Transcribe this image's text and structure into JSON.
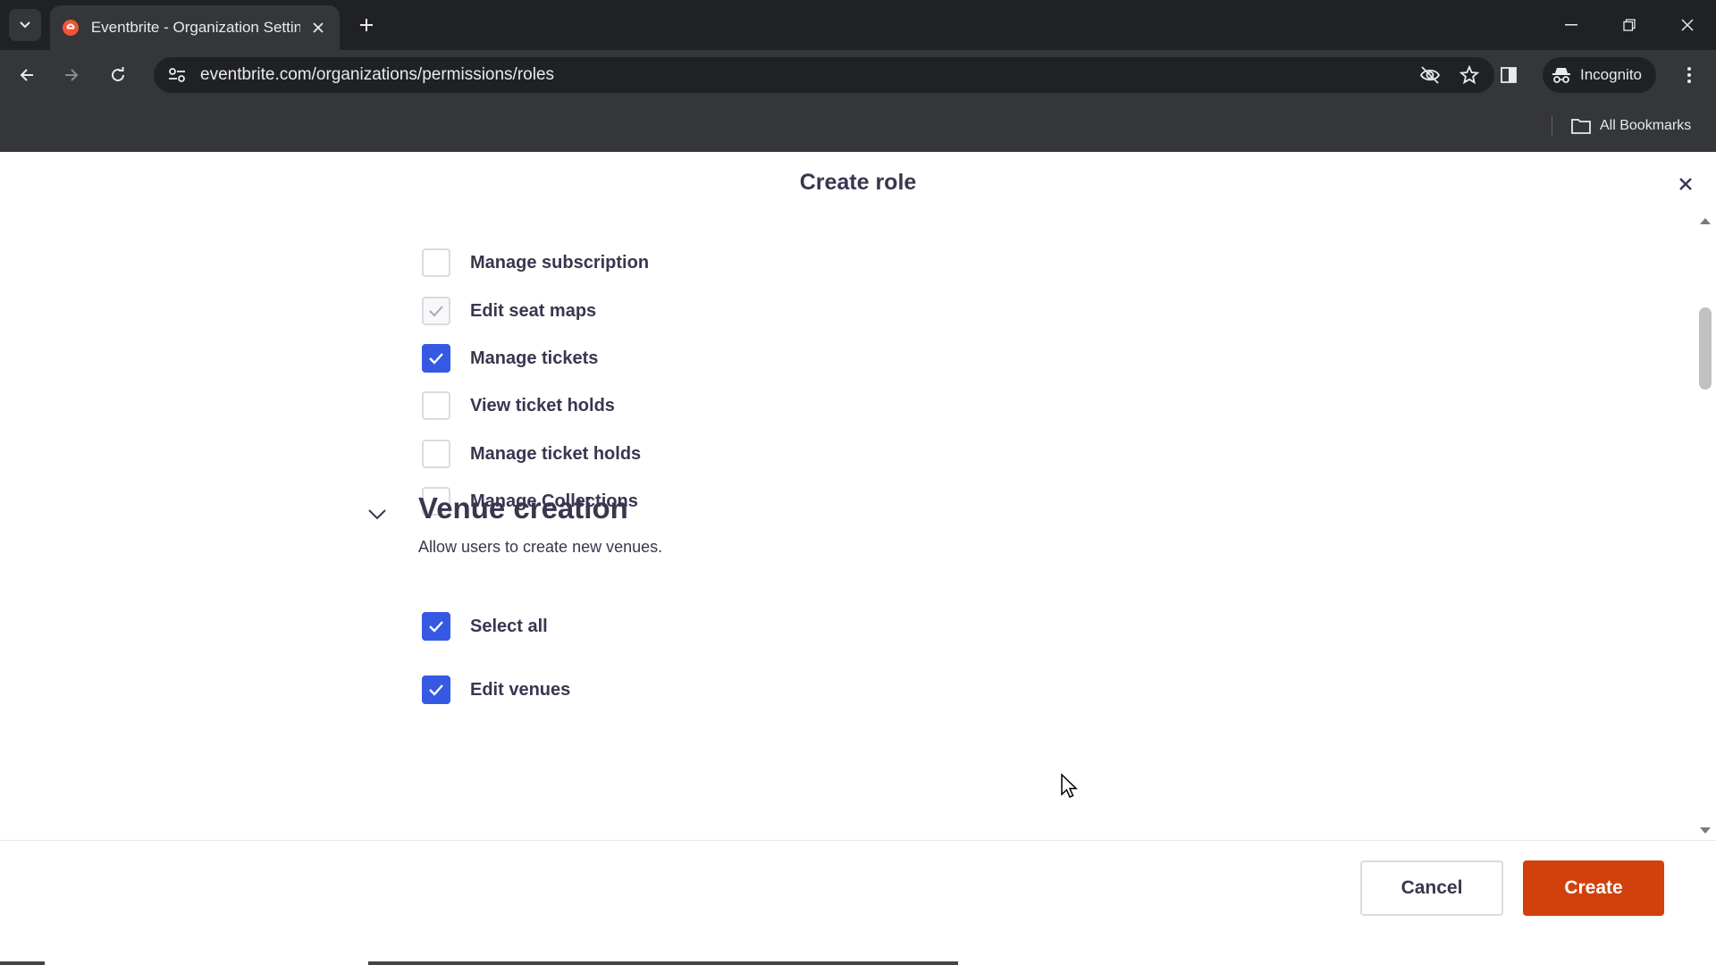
{
  "browser": {
    "tab_title": "Eventbrite - Organization Settin",
    "url": "eventbrite.com/organizations/permissions/roles",
    "incognito_label": "Incognito",
    "bookmarks_label": "All Bookmarks"
  },
  "modal": {
    "title": "Create role",
    "permissions": [
      {
        "label": "Manage subscription",
        "state": "unchecked"
      },
      {
        "label": "Edit seat maps",
        "state": "disabled-checked"
      },
      {
        "label": "Manage tickets",
        "state": "checked"
      },
      {
        "label": "View ticket holds",
        "state": "unchecked"
      },
      {
        "label": "Manage ticket holds",
        "state": "unchecked"
      },
      {
        "label": "Manage Collections",
        "state": "unchecked"
      }
    ],
    "venue_section": {
      "title": "Venue creation",
      "description": "Allow users to create new venues.",
      "items": [
        {
          "label": "Select all",
          "state": "checked"
        },
        {
          "label": "Edit venues",
          "state": "checked"
        }
      ]
    },
    "cancel_label": "Cancel",
    "create_label": "Create"
  },
  "colors": {
    "accent_blue": "#3659e3",
    "create_orange": "#d1410c",
    "text_dark": "#39364f"
  }
}
